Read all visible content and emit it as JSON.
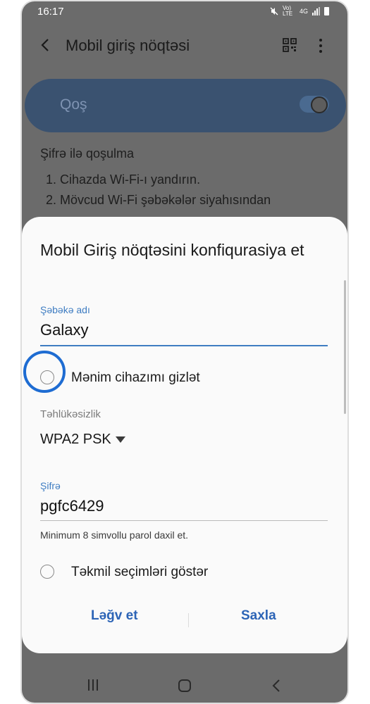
{
  "status_bar": {
    "time": "16:17",
    "volte": "Vo) LTE",
    "network": "4G"
  },
  "app_bar": {
    "title": "Mobil giriş nöqtəsi",
    "icons": [
      "back-icon",
      "qr-code-icon",
      "more-options-icon"
    ]
  },
  "hotspot_toggle": {
    "label": "Qoş",
    "state": "on"
  },
  "background_content": {
    "heading": "Şifrə ilə qoşulma",
    "steps": [
      "1. Cihazda Wi-Fi-ı yandırın.",
      "2. Mövcud Wi-Fi şəbəkələr siyahısından"
    ]
  },
  "dialog": {
    "title": "Mobil Giriş nöqtəsini konfiqurasiya et",
    "network_name": {
      "label": "Şəbəkə adı",
      "value": "Galaxy"
    },
    "hide_device": {
      "label": "Mənim cihazımı gizlət",
      "checked": false
    },
    "security": {
      "label": "Təhlükəsizlik",
      "value": "WPA2 PSK"
    },
    "password": {
      "label": "Şifrə",
      "value": "pgfc6429",
      "helper": "Minimum 8 simvollu parol daxil et."
    },
    "advanced": {
      "label": "Təkmil seçimləri göstər",
      "checked": false
    },
    "buttons": {
      "cancel": "Ləğv et",
      "save": "Saxla"
    }
  },
  "nav_bar": {
    "icons": [
      "recent-apps-icon",
      "home-icon",
      "back-nav-icon"
    ]
  },
  "colors": {
    "accent": "#3f7dc2",
    "button_text": "#2c64b6",
    "highlight_ring": "#1e6cd2",
    "dim_background": "#6b6b6b",
    "dialog_background": "#fafafa"
  }
}
